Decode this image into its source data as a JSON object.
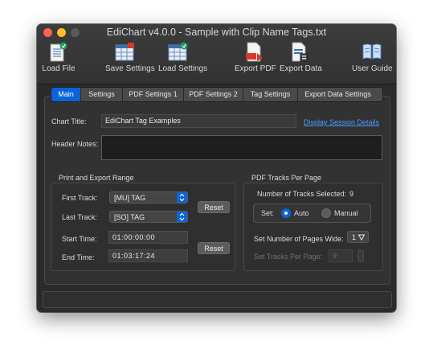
{
  "window": {
    "title": "EdiChart v4.0.0 - Sample with Clip Name Tags.txt"
  },
  "toolbar": {
    "load_file": "Load File",
    "save_settings": "Save Settings",
    "load_settings": "Load Settings",
    "export_pdf": "Export PDF",
    "export_data": "Export Data",
    "user_guide": "User Guide"
  },
  "tabs": [
    "Main",
    "Settings",
    "PDF Settings 1",
    "PDF Settings 2",
    "Tag Settings",
    "Export Data Settings"
  ],
  "main": {
    "chart_title_label": "Chart Title:",
    "chart_title_value": "EdiChart Tag Examples",
    "display_session_link": "Display Session Details",
    "header_notes_label": "Header Notes:",
    "header_notes_value": ""
  },
  "range": {
    "heading": "Print and Export Range",
    "first_track_label": "First Track:",
    "first_track_value": "[MU] TAG",
    "last_track_label": "Last Track:",
    "last_track_value": "[SO] TAG",
    "reset_label": "Reset",
    "start_time_label": "Start Time:",
    "start_time_value": "01:00:00:00",
    "end_time_label": "End Time:",
    "end_time_value": "01:03:17:24",
    "reset2_label": "Reset"
  },
  "pdf_tracks": {
    "heading": "PDF Tracks Per Page",
    "num_selected_label": "Number of Tracks Selected:",
    "num_selected_value": "9",
    "set_label": "Set:",
    "auto_label": "Auto",
    "manual_label": "Manual",
    "selected_mode": "Auto",
    "pages_wide_label": "Set Number of Pages Wide:",
    "pages_wide_value": "1",
    "tracks_per_page_label": "Set Tracks Per Page:",
    "tracks_per_page_value": "9"
  },
  "colors": {
    "accent": "#0a64d6",
    "link": "#4c9eff",
    "close": "#fe5f57",
    "minimize": "#febc2e"
  }
}
